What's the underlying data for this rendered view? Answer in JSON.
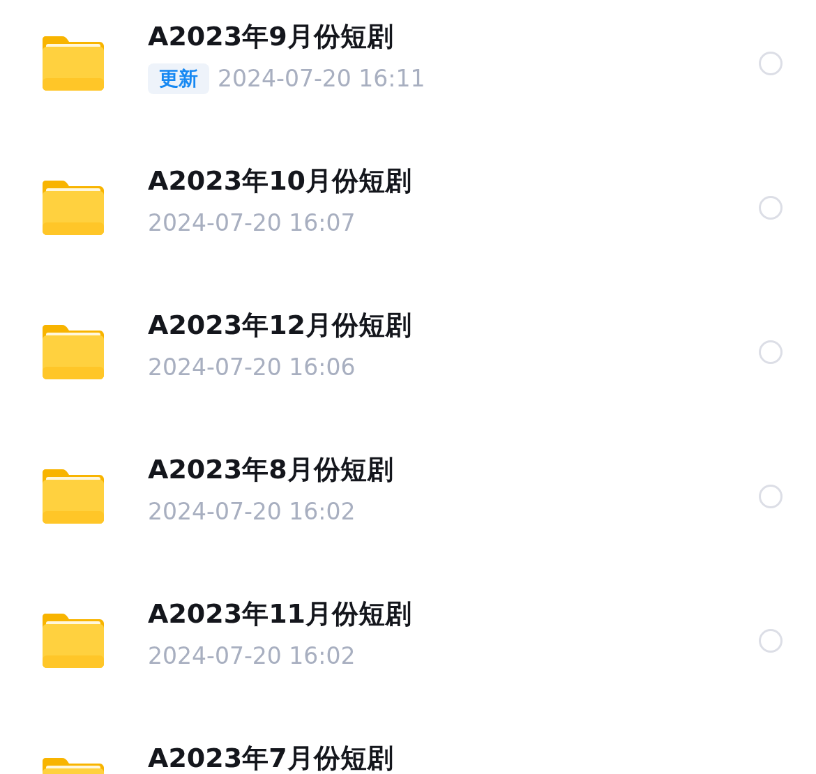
{
  "files": [
    {
      "name": "A2023年9月份短剧",
      "badge": "更新",
      "modified": "2024-07-20 16:11",
      "selected": false
    },
    {
      "name": "A2023年10月份短剧",
      "modified": "2024-07-20 16:07",
      "selected": false
    },
    {
      "name": "A2023年12月份短剧",
      "modified": "2024-07-20 16:06",
      "selected": false
    },
    {
      "name": "A2023年8月份短剧",
      "modified": "2024-07-20 16:02",
      "selected": false
    },
    {
      "name": "A2023年11月份短剧",
      "modified": "2024-07-20 16:02",
      "selected": false
    },
    {
      "name": "A2023年7月份短剧"
    }
  ]
}
